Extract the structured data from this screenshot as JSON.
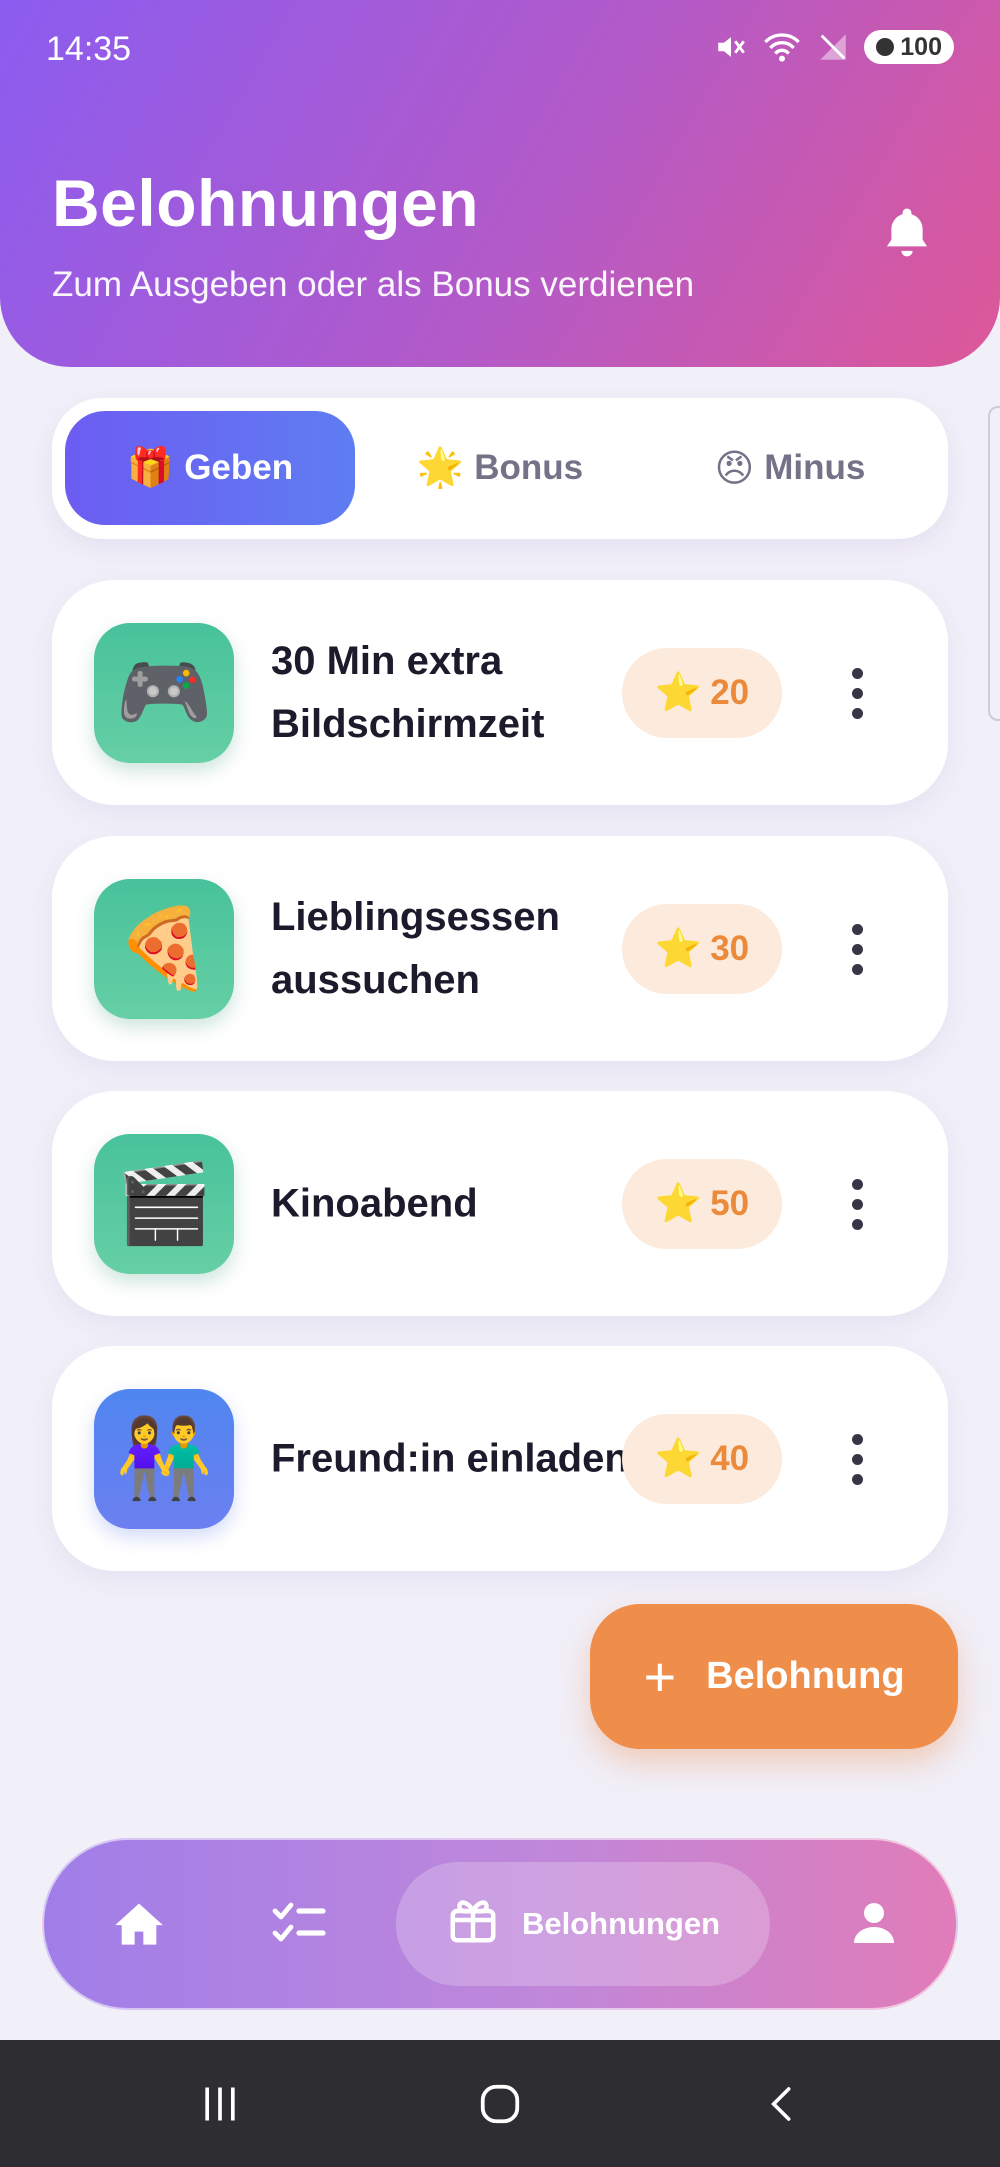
{
  "status_bar": {
    "time": "14:35",
    "battery": "100"
  },
  "header": {
    "title": "Belohnungen",
    "subtitle": "Zum Ausgeben oder als Bonus verdienen"
  },
  "tabs": [
    {
      "emoji": "🎁",
      "label": "Geben",
      "active": true
    },
    {
      "emoji": "🌟",
      "label": "Bonus",
      "active": false
    },
    {
      "emoji": "😠",
      "label": "Minus",
      "active": false
    }
  ],
  "rewards": [
    {
      "emoji": "🎮",
      "icon": "gamepad-icon",
      "title": "30 Min extra Bildschirmzeit",
      "cost": "20",
      "color": "#5cc9a1"
    },
    {
      "emoji": "🍕",
      "icon": "pizza-icon",
      "title": "Lieblingsessen aussuchen",
      "cost": "30",
      "color": "#5cc9a1"
    },
    {
      "emoji": "🎬",
      "icon": "clapper-icon",
      "title": "Kinoabend",
      "cost": "50",
      "color": "#5cc9a1"
    },
    {
      "emoji": "👫",
      "icon": "friends-icon",
      "title": "Freund:in einladen",
      "cost": "40",
      "color": "#5f82f0"
    }
  ],
  "cost_star": "⭐",
  "fab": {
    "plus": "+",
    "label": "Belohnung"
  },
  "bottom_nav": {
    "items": [
      {
        "icon": "home-icon"
      },
      {
        "icon": "tasks-icon"
      },
      {
        "icon": "gift-icon",
        "label": "Belohnungen",
        "active": true
      },
      {
        "icon": "profile-icon"
      }
    ]
  },
  "colors": {
    "accent": "#6c5cf2",
    "fab": "#ef8d4b",
    "cost": "#ec8a3c"
  }
}
